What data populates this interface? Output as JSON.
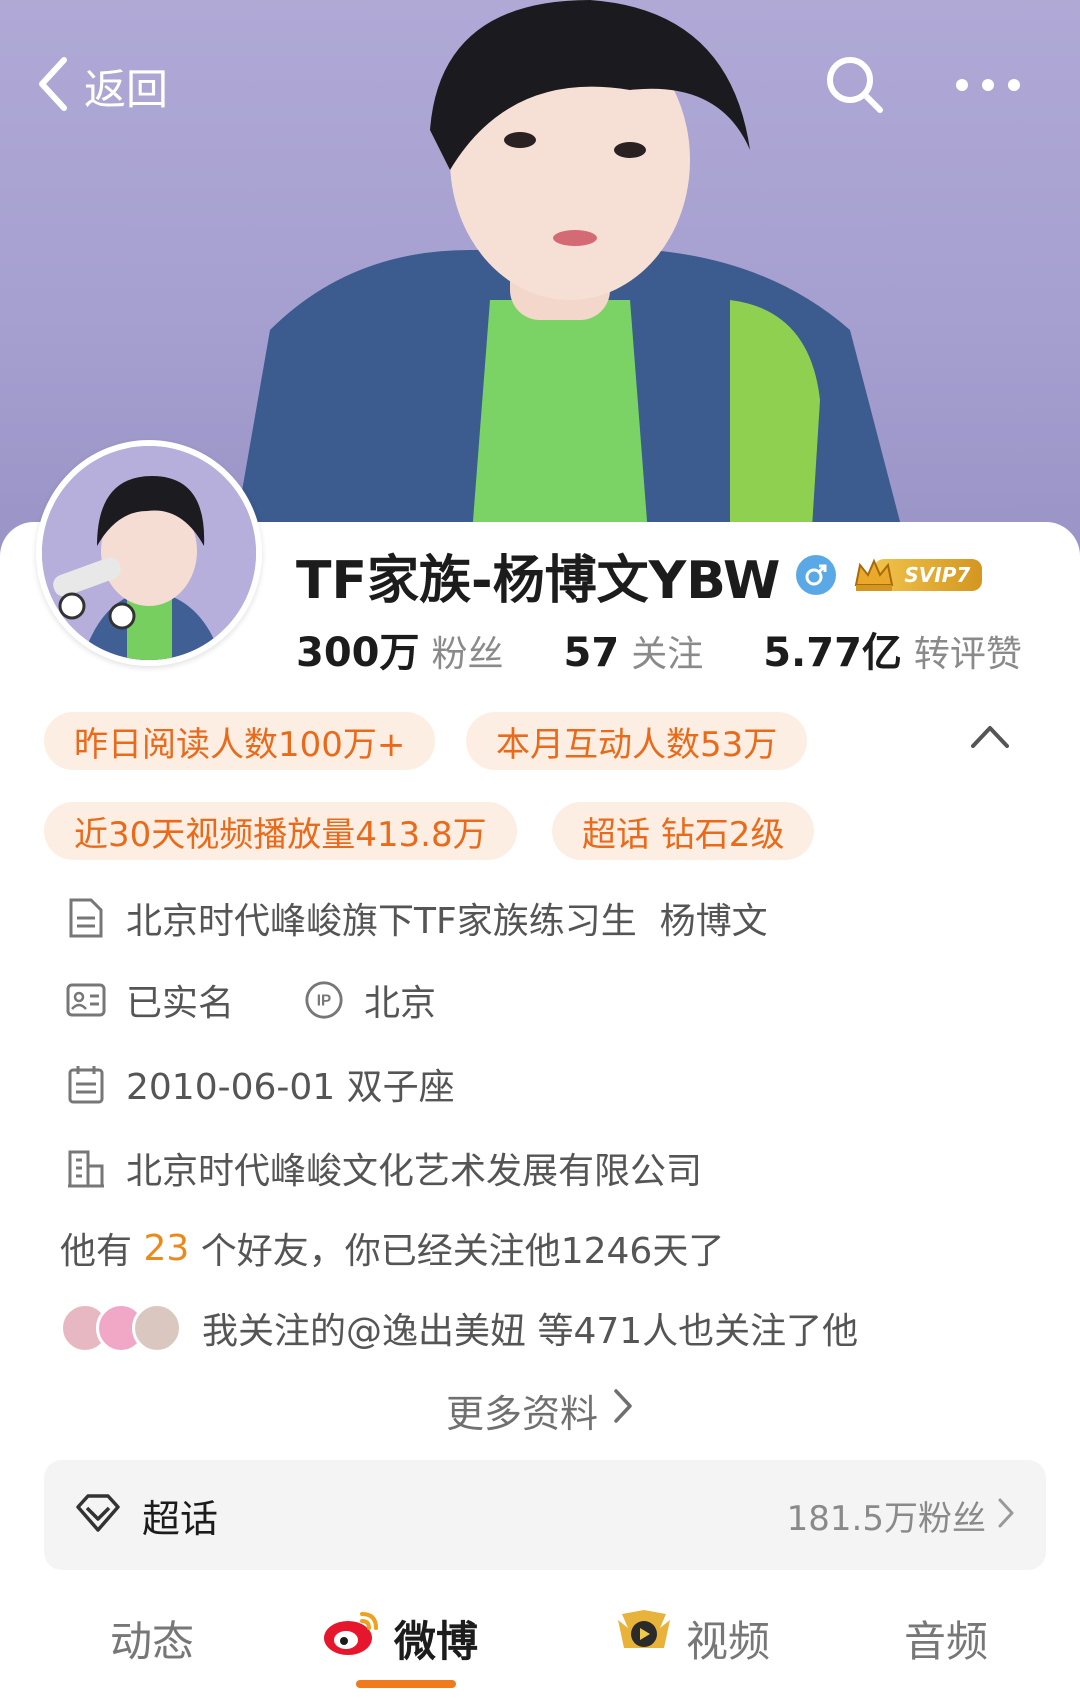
{
  "header": {
    "back_label": "返回"
  },
  "profile": {
    "name": "TF家族-杨博文YBW",
    "vip_badge": "SVIP7",
    "stats": [
      {
        "value": "300万",
        "label": "粉丝"
      },
      {
        "value": "57",
        "label": "关注"
      },
      {
        "value": "5.77亿",
        "label": "转评赞"
      }
    ]
  },
  "tags": [
    "昨日阅读人数100万+",
    "本月互动人数53万",
    "近30天视频播放量413.8万",
    "超话 钻石2级"
  ],
  "info": {
    "bio": "北京时代峰峻旗下TF家族练习生  杨博文",
    "verified": "已实名",
    "ip": "北京",
    "birthday": "2010-06-01 双子座",
    "company": "北京时代峰峻文化艺术发展有限公司"
  },
  "friends": {
    "prefix": "他有 ",
    "count": "23",
    "suffix": " 个好友，你已经关注他1246天了"
  },
  "mutual": {
    "text": "我关注的@逸出美妞 等471人也关注了他"
  },
  "more_info_label": "更多资料",
  "super_topic": {
    "title": "超话",
    "fans": "181.5万粉丝"
  },
  "tabs": [
    {
      "label": "动态"
    },
    {
      "label": "微博"
    },
    {
      "label": "视频"
    },
    {
      "label": "音频"
    }
  ],
  "colors": {
    "accent": "#ea6a1b",
    "tag_bg": "#fdeee3",
    "gender": "#5aa9e6",
    "tab_underline": "#f07a1c"
  }
}
